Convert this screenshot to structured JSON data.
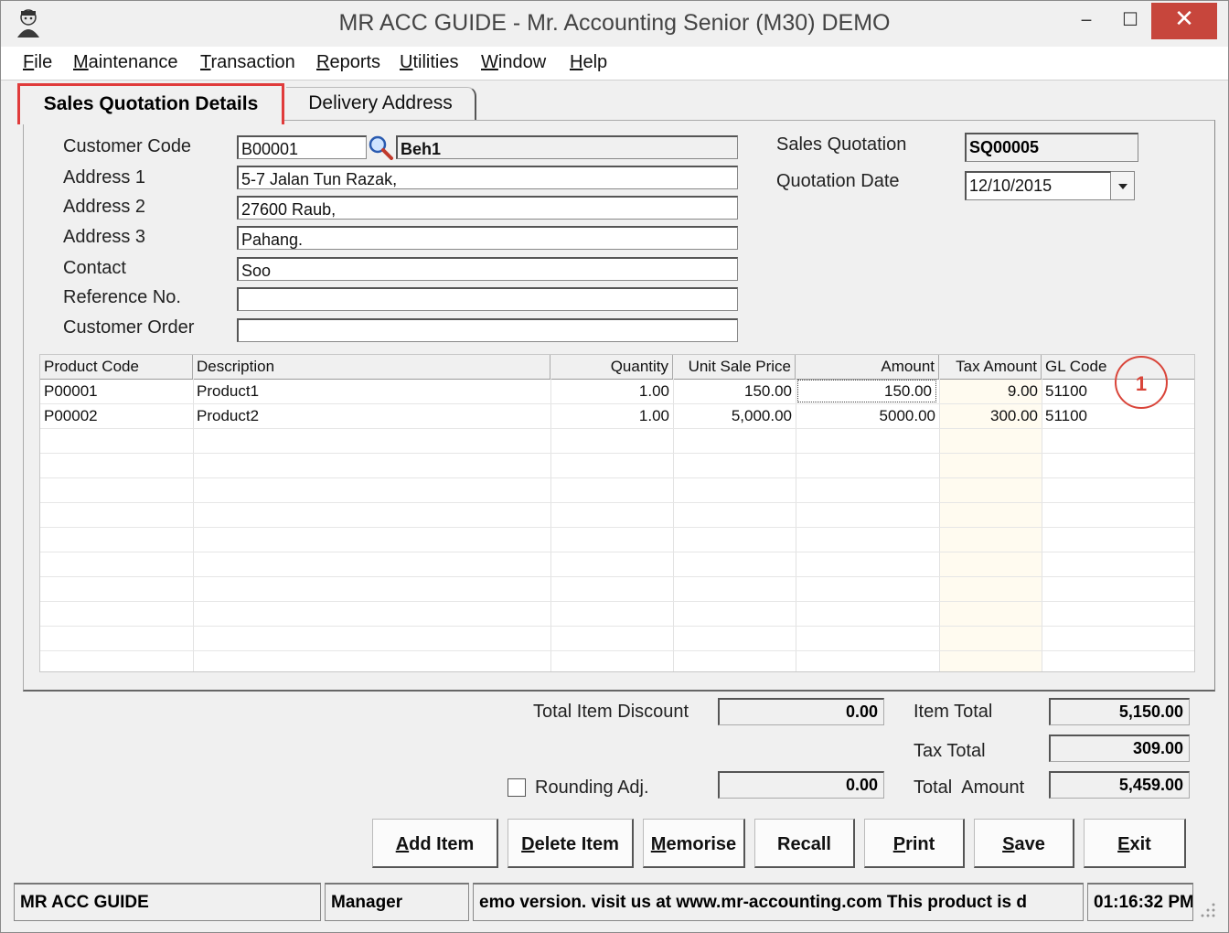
{
  "window": {
    "title": "MR ACC GUIDE - Mr. Accounting Senior (M30) DEMO",
    "minimize_glyph": "‒",
    "maximize_glyph": "☐",
    "close_glyph": "✕"
  },
  "menu": [
    {
      "underline": "F",
      "rest": "ile"
    },
    {
      "underline": "M",
      "rest": "aintenance"
    },
    {
      "underline": "T",
      "rest": "ransaction"
    },
    {
      "underline": "R",
      "rest": "eports"
    },
    {
      "underline": "U",
      "rest": "tilities"
    },
    {
      "underline": "W",
      "rest": "indow"
    },
    {
      "underline": "H",
      "rest": "elp"
    }
  ],
  "tabs": {
    "active": "Sales Quotation Details",
    "inactive": "Delivery Address"
  },
  "form": {
    "customer_code_label": "Customer Code",
    "customer_code": "B00001",
    "customer_name": "Beh1",
    "address1_label": "Address 1",
    "address1": "5-7 Jalan Tun Razak,",
    "address2_label": "Address 2",
    "address2": "27600 Raub,",
    "address3_label": "Address 3",
    "address3": "Pahang.",
    "contact_label": "Contact",
    "contact": "Soo",
    "reference_label": "Reference No.",
    "reference": "",
    "customer_order_label": "Customer Order",
    "customer_order": "",
    "sales_quotation_label": "Sales Quotation",
    "sales_quotation": "SQ00005",
    "quotation_date_label": "Quotation Date",
    "quotation_date": "12/10/2015"
  },
  "grid": {
    "headers": [
      "Product Code",
      "Description",
      "Quantity",
      "Unit Sale Price",
      "Amount",
      "Tax Amount",
      "GL Code"
    ],
    "rows": [
      [
        "P00001",
        "Product1",
        "1.00",
        "150.00",
        "150.00",
        "9.00",
        "51100"
      ],
      [
        "P00002",
        "Product2",
        "1.00",
        "5,000.00",
        "5000.00",
        "300.00",
        "51100"
      ]
    ]
  },
  "annotation": "1",
  "totals": {
    "total_item_discount_label": "Total Item Discount",
    "total_item_discount": "0.00",
    "rounding_label": "Rounding Adj.",
    "rounding": "0.00",
    "item_total_label": "Item Total",
    "item_total": "5,150.00",
    "tax_total_label": "Tax Total",
    "tax_total": "309.00",
    "total_amount_label": "Total  Amount",
    "total_amount": "5,459.00"
  },
  "buttons": [
    {
      "underline": "A",
      "rest": "dd Item"
    },
    {
      "underline": "D",
      "rest": "elete Item"
    },
    {
      "underline": "M",
      "rest": "emorise"
    },
    {
      "underline": "",
      "rest": "Recall"
    },
    {
      "underline": "P",
      "rest": "rint"
    },
    {
      "underline": "S",
      "rest": "ave"
    },
    {
      "underline": "E",
      "rest": "xit"
    }
  ],
  "status": {
    "app": "MR ACC GUIDE",
    "user": "Manager",
    "message": "emo version.  visit us at www.mr-accounting.com This product is d",
    "time": "01:16:32 PM"
  }
}
